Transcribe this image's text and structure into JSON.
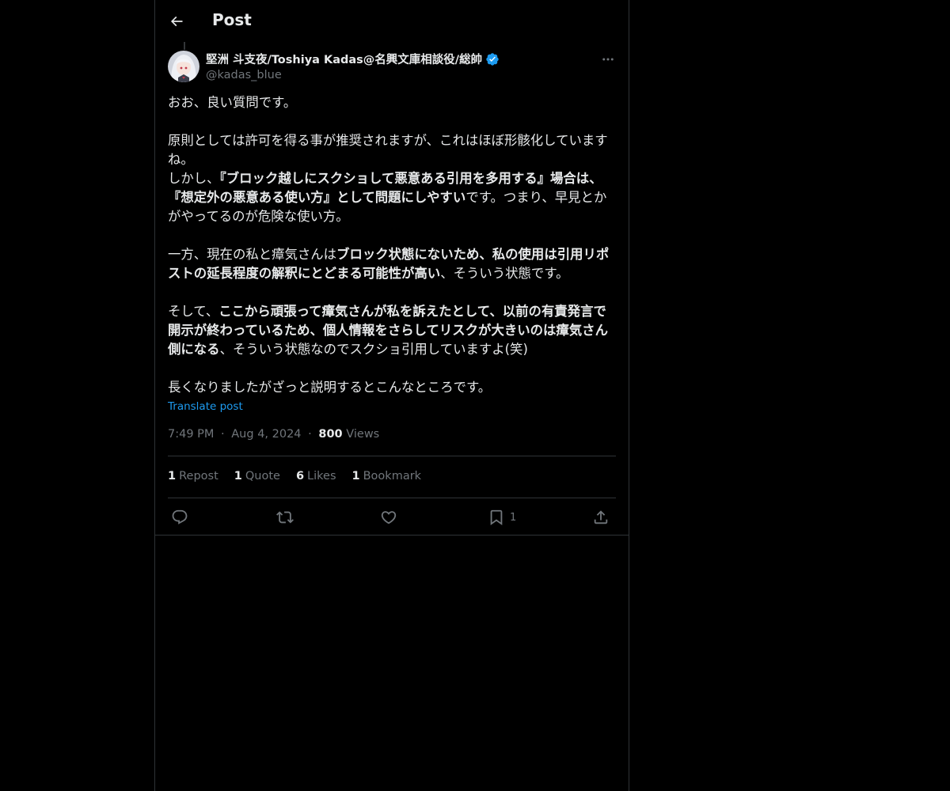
{
  "header": {
    "title": "Post"
  },
  "author": {
    "display_name": "堅洲 斗支夜/Toshiya Kadas@名興文庫相談役/総帥",
    "handle": "@kadas_blue"
  },
  "post": {
    "paragraphs": [
      [
        "おお、良い質問です。"
      ],
      [],
      [
        "原則としては許可を得る事が推奨されますが、これはほぼ形骸化していますね。"
      ],
      [
        "しかし、",
        {
          "b": "『ブロック越しにスクショして悪意ある引用を多用する』場合は、『想定外の悪意ある使い方』として問題にしやすい"
        },
        "です。つまり、早見とかがやってるのが危険な使い方。"
      ],
      [],
      [
        "一方、現在の私と瘴気さんは",
        {
          "b": "ブロック状態にないため、私の使用は引用リポストの延長程度の解釈にとどまる可能性が高い"
        },
        "、そういう状態です。"
      ],
      [],
      [
        "そして、",
        {
          "b": "ここから頑張って瘴気さんが私を訴えたとして、以前の有責発言で開示が終わっているため、個人情報をさらしてリスクが大きいのは瘴気さん側になる"
        },
        "、そういう状態なのでスクショ引用していますよ(笑)"
      ],
      [],
      [
        "長くなりましたがざっと説明するとこんなところです。"
      ]
    ],
    "translate_label": "Translate post",
    "time": "7:49 PM",
    "date": "Aug 4, 2024",
    "views_count": "800",
    "views_label": "Views",
    "dot": "·"
  },
  "stats": {
    "reposts": {
      "count": "1",
      "label": "Repost"
    },
    "quotes": {
      "count": "1",
      "label": "Quote"
    },
    "likes": {
      "count": "6",
      "label": "Likes"
    },
    "bookmarks": {
      "count": "1",
      "label": "Bookmark"
    }
  },
  "actions": {
    "bookmark_count": "1"
  },
  "colors": {
    "background": "#000000",
    "text": "#e7e9ea",
    "muted": "#71767b",
    "accent": "#1d9bf0",
    "border": "#2f3336"
  }
}
